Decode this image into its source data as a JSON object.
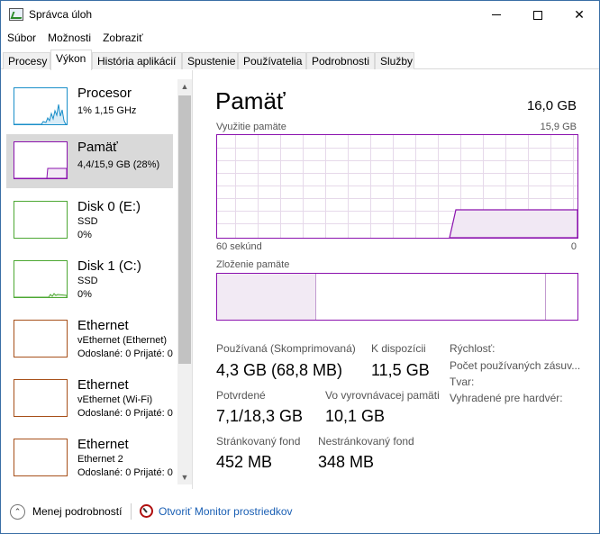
{
  "window": {
    "title": "Správca úloh",
    "icon": "task-manager-icon"
  },
  "menu": [
    "Súbor",
    "Možnosti",
    "Zobraziť"
  ],
  "tabs": [
    "Procesy",
    "Výkon",
    "História aplikácií",
    "Spustenie",
    "Používatelia",
    "Podrobnosti",
    "Služby"
  ],
  "active_tab": "Výkon",
  "sidebar": [
    {
      "title": "Procesor",
      "line1": "1%  1,15 GHz",
      "line2": "",
      "color": "#1a8fc9"
    },
    {
      "title": "Pamäť",
      "line1": "4,4/15,9 GB (28%)",
      "line2": "",
      "color": "#8b12ae"
    },
    {
      "title": "Disk 0 (E:)",
      "line1": "SSD",
      "line2": "0%",
      "color": "#4da833"
    },
    {
      "title": "Disk 1 (C:)",
      "line1": "SSD",
      "line2": "0%",
      "color": "#4da833"
    },
    {
      "title": "Ethernet",
      "line1": "vEthernet (Ethernet)",
      "sent_label": "Odoslané:",
      "sent": "0",
      "recv_label": "Prijaté:",
      "recv": "0",
      "color": "#a7501a"
    },
    {
      "title": "Ethernet",
      "line1": "vEthernet (Wi-Fi)",
      "sent_label": "Odoslané:",
      "sent": "0",
      "recv_label": "Prijaté:",
      "recv": "0",
      "color": "#a7501a"
    },
    {
      "title": "Ethernet",
      "line1": "Ethernet 2",
      "sent_label": "Odoslané:",
      "sent": "0",
      "recv_label": "Prijaté:",
      "recv": "0",
      "color": "#a7501a"
    }
  ],
  "memory": {
    "title": "Pamäť",
    "total": "16,0 GB",
    "usage_label": "Využitie pamäte",
    "usage_max": "15,9 GB",
    "time_left": "60 sekúnd",
    "time_right": "0",
    "composition_label": "Zloženie pamäte",
    "in_use_fraction": 0.28,
    "stats": {
      "in_use_label": "Používaná (Skomprimovaná)",
      "in_use_value": "4,3 GB (68,8 MB)",
      "available_label": "K dispozícii",
      "available_value": "11,5 GB",
      "committed_label": "Potvrdené",
      "committed_value": "7,1/18,3 GB",
      "cached_label": "Vo vyrovnávacej pamäti",
      "cached_value": "10,1 GB",
      "paged_label": "Stránkovaný fond",
      "paged_value": "452 MB",
      "nonpaged_label": "Nestránkovaný fond",
      "nonpaged_value": "348 MB"
    },
    "props": {
      "speed": "Rýchlosť:",
      "slots": "Počet používaných zásuv...",
      "form": "Tvar:",
      "reserved": "Vyhradené pre hardvér:"
    },
    "accent": "#8b12ae"
  },
  "footer": {
    "less_details": "Menej podrobností",
    "open_monitor": "Otvoriť Monitor prostriedkov"
  }
}
